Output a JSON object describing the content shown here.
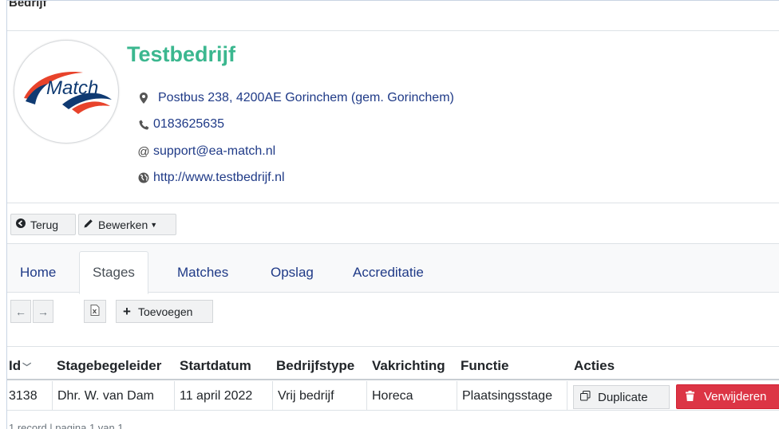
{
  "section_title": "Bedrijf",
  "company": {
    "name": "Testbedrijf",
    "address": "Postbus 238, 4200AE Gorinchem (gem. Gorinchem)",
    "phone": "0183625635",
    "email": "support@ea-match.nl",
    "website": "http://www.testbedrijf.nl",
    "logo_text": "Match"
  },
  "actions": {
    "back_label": "Terug",
    "edit_label": "Bewerken"
  },
  "tabs": [
    {
      "label": "Home",
      "active": false
    },
    {
      "label": "Stages",
      "active": true
    },
    {
      "label": "Matches",
      "active": false
    },
    {
      "label": "Opslag",
      "active": false
    },
    {
      "label": "Accreditatie",
      "active": false
    }
  ],
  "toolbar": {
    "add_label": "Toevoegen"
  },
  "table": {
    "headers": [
      "Id",
      "Stagebegeleider",
      "Startdatum",
      "Bedrijfstype",
      "Vakrichting",
      "Functie",
      "Acties"
    ],
    "rows": [
      {
        "id": "3138",
        "stagebegeleider": "Dhr. W. van Dam",
        "startdatum": "11 april 2022",
        "bedrijfstype": "Vrij bedrijf",
        "vakrichting": "Horeca",
        "functie": "Plaatsingsstage",
        "duplicate_label": "Duplicate",
        "delete_label": "Verwijderen"
      }
    ]
  },
  "footer": "1 record | pagina 1 van 1",
  "colors": {
    "company_name": "#3bb78f",
    "link": "#1f3a87",
    "danger": "#dc3545"
  }
}
